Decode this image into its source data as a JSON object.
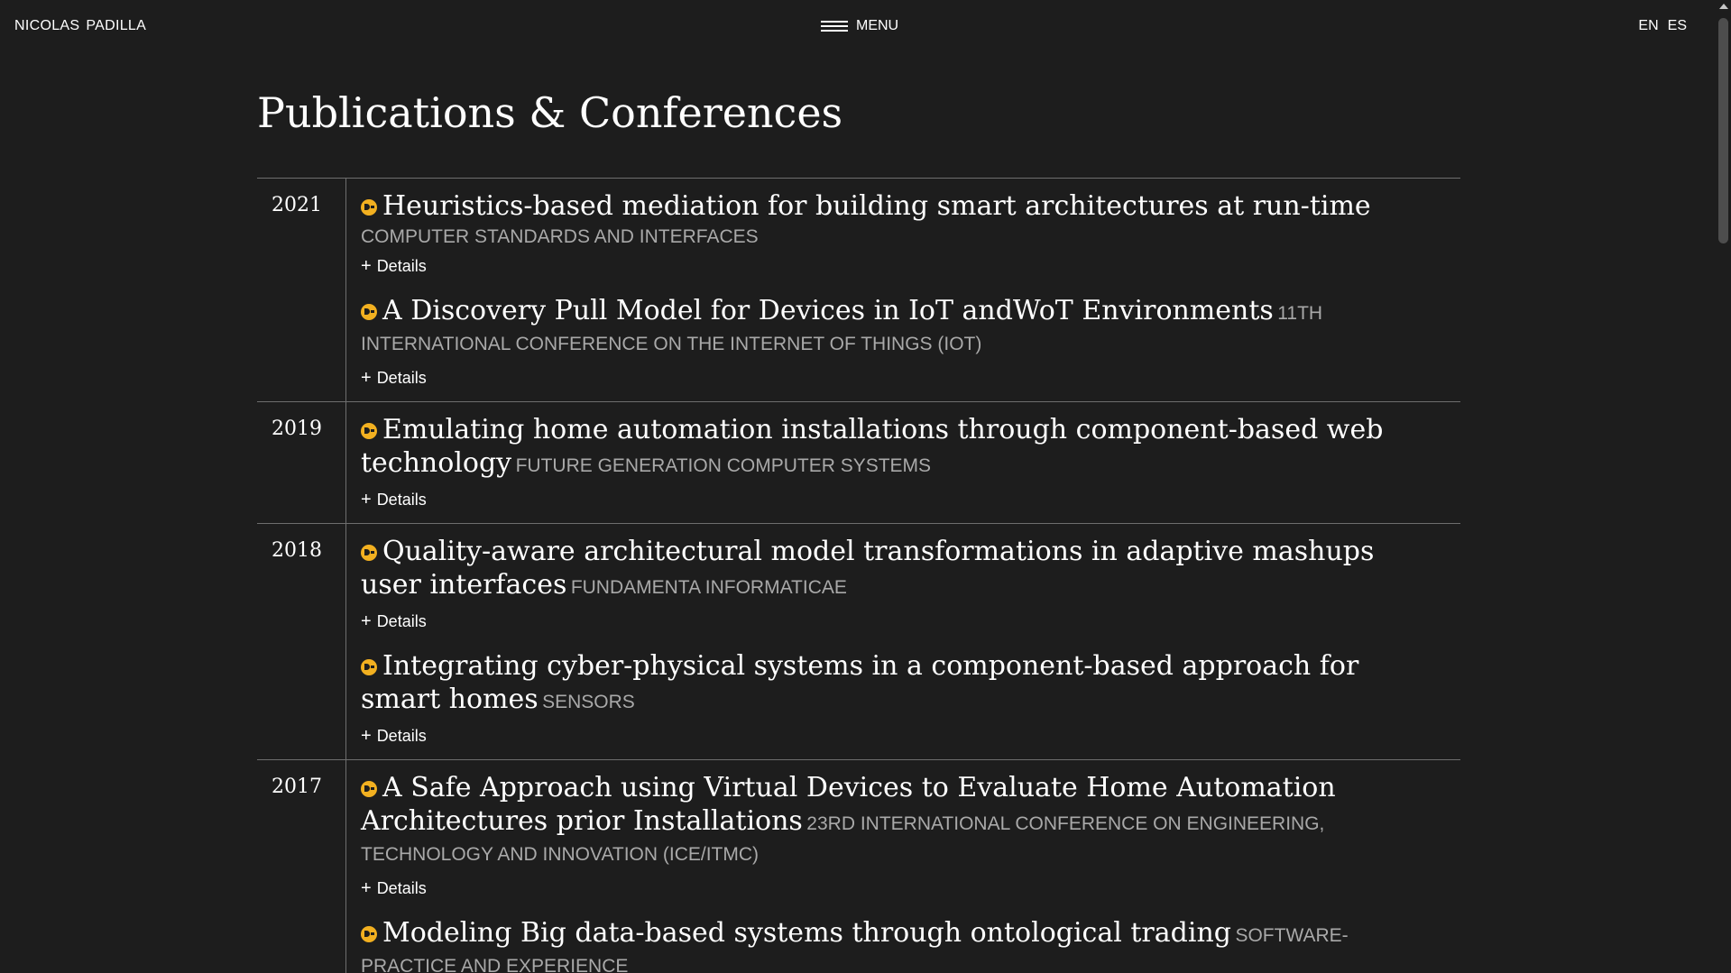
{
  "header": {
    "brand": [
      "NICOLAS",
      "PADILLA"
    ],
    "menu_label": "MENU",
    "languages": [
      "EN",
      "ES"
    ]
  },
  "page_title": "Publications & Conferences",
  "details_label": "Details",
  "colors": {
    "background": "#1d1d1d",
    "accent": "#f2b020",
    "muted": "#a9a9a9",
    "divider": "#6e6e6e"
  },
  "years": [
    {
      "year": "2021",
      "entries": [
        {
          "title": "Heuristics-based mediation for building smart architectures at run-time",
          "venue": "COMPUTER STANDARDS AND INTERFACES",
          "venue_block": true
        },
        {
          "title": "A Discovery Pull Model for Devices in IoT andWoT Environments",
          "venue": "11TH INTERNATIONAL CONFERENCE ON THE INTERNET OF THINGS (IOT)",
          "venue_block": false
        }
      ]
    },
    {
      "year": "2019",
      "entries": [
        {
          "title": "Emulating home automation installations through component-based web technology",
          "venue": "FUTURE GENERATION COMPUTER SYSTEMS",
          "venue_block": false
        }
      ]
    },
    {
      "year": "2018",
      "entries": [
        {
          "title": "Quality-aware architectural model transformations in adaptive mashups user interfaces",
          "venue": "FUNDAMENTA INFORMATICAE",
          "venue_block": false
        },
        {
          "title": "Integrating cyber-physical systems in a component-based approach for smart homes",
          "venue": "SENSORS",
          "venue_block": false
        }
      ]
    },
    {
      "year": "2017",
      "entries": [
        {
          "title": "A Safe Approach using Virtual Devices to Evaluate Home Automation Architectures prior Installations",
          "venue": "23RD INTERNATIONAL CONFERENCE ON ENGINEERING, TECHNOLOGY AND INNOVATION (ICE/ITMC)",
          "venue_block": false
        },
        {
          "title": "Modeling Big data-based systems through ontological trading",
          "venue": "SOFTWARE-PRACTICE AND EXPERIENCE",
          "venue_block": false,
          "no_details": true
        }
      ]
    }
  ]
}
